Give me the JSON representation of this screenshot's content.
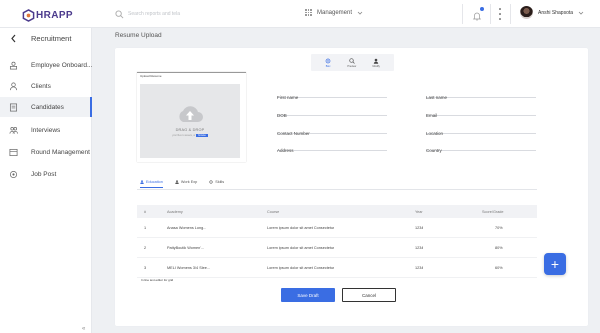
{
  "app": {
    "brand": "HRAPP"
  },
  "topbar": {
    "search_placeholder": "Search reports and tela",
    "module": "Management",
    "user_name": "Anshi Shapsota"
  },
  "sidebar": {
    "title": "Recruitment",
    "items": [
      {
        "label": "Employee Onboard...",
        "icon": "onboard-icon"
      },
      {
        "label": "Clients",
        "icon": "clients-icon"
      },
      {
        "label": "Candidates",
        "icon": "candidates-icon",
        "active": true
      },
      {
        "label": "Interviews",
        "icon": "interviews-icon"
      },
      {
        "label": "Round Management",
        "icon": "round-icon"
      },
      {
        "label": "Job Post",
        "icon": "jobpost-icon"
      }
    ],
    "collapse": "«"
  },
  "page": {
    "title": "Resume Upload"
  },
  "view_tabs": [
    {
      "label": "Bsic",
      "icon": "gear-icon",
      "active": true
    },
    {
      "label": "Preview",
      "icon": "search-icon"
    },
    {
      "label": "Modify",
      "icon": "user-icon"
    }
  ],
  "resume": {
    "heading": "Upload Resume",
    "drop_title": "DRAG & DROP",
    "drop_sub": "your files to assets, or",
    "drop_link": "browse"
  },
  "form": {
    "first_name": "First name",
    "last_name": "Last name",
    "dob": "DOB",
    "email": "Email",
    "contact": "Contact Number",
    "location": "Location",
    "address": "Address",
    "country": "Country"
  },
  "sub_tabs": [
    {
      "label": "Education",
      "active": true
    },
    {
      "label": "Work Exp"
    },
    {
      "label": "Skills"
    }
  ],
  "table": {
    "headers": [
      "#",
      "Academy",
      "Course",
      "Year",
      "Score/Grade"
    ],
    "rows": [
      [
        "1",
        "Anasa Womens Long...",
        "Lorem ipsum dolor sit amet Consectetur",
        "1234",
        "70%"
      ],
      [
        "2",
        "PattyBoutik Women'...",
        "Lorem ipsum dolor sit amet Consectetur",
        "1234",
        "80%"
      ],
      [
        "3",
        "MELI Womens 3/4 Slee...",
        "Lorem ipsum dolor sit amet Consectetur",
        "1234",
        "60%"
      ]
    ],
    "note": "In line text editor for grid"
  },
  "actions": {
    "save": "Save Draft",
    "cancel": "Cancel",
    "fab": "+"
  },
  "colors": {
    "accent": "#3a6de3",
    "brand": "#4b3a8c"
  }
}
